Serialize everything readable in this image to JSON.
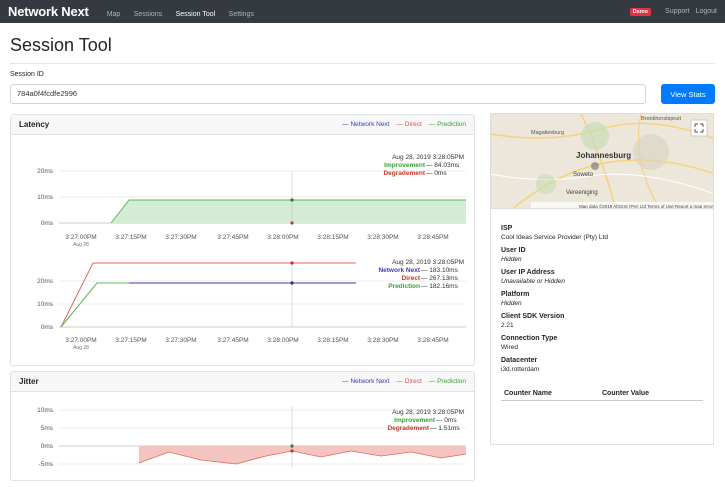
{
  "nav": {
    "brand": "Network Next",
    "links": [
      "Map",
      "Sessions",
      "Session Tool",
      "Settings"
    ],
    "badge": "Demo",
    "support": "Support",
    "logout": "Logout"
  },
  "page": {
    "title": "Session Tool",
    "session_label": "Session ID",
    "session_value": "784a0f4fcdfe2996",
    "view_button": "View Stats"
  },
  "latency": {
    "title": "Latency",
    "legend": [
      "— Network Next",
      "— Direct",
      "— Prediction"
    ],
    "chart1": {
      "timestamp": "Aug 28, 2019 3:28:05PM",
      "line1": "Improvement",
      "line1_val": "— 84.03ms",
      "line2": "Degradement",
      "line2_val": "— 0ms",
      "yticks": [
        "20ms",
        "10ms",
        "0ms"
      ]
    },
    "chart2": {
      "timestamp": "Aug 28, 2019 3:28:05PM",
      "line1": "Network Next",
      "line1_val": "— 183.10ms",
      "line2": "Direct",
      "line2_val": "— 267.13ms",
      "line3": "Prediction",
      "line3_val": "— 182.16ms",
      "yticks": [
        "20ms",
        "10ms",
        "0ms"
      ]
    },
    "xticks": [
      "3:27:00PM",
      "3:27:15PM",
      "3:27:30PM",
      "3:27:45PM",
      "3:28:00PM",
      "3:28:15PM",
      "3:28:30PM",
      "3:28:45PM"
    ],
    "xsub": "Aug 28"
  },
  "jitter": {
    "title": "Jitter",
    "legend": [
      "— Network Next",
      "— Direct",
      "— Prediction"
    ],
    "timestamp": "Aug 28, 2019 3:28:05PM",
    "line1": "Improvement",
    "line1_val": "— 0ms",
    "line2": "Degradement",
    "line2_val": "— 1.51ms",
    "yticks": [
      "10ms",
      "5ms",
      "0ms",
      "-5ms"
    ]
  },
  "map": {
    "labels": [
      "Johannesburg",
      "Soweto",
      "Vereeniging",
      "Magaliesburg",
      "Bronkhorstspruit"
    ],
    "attribution": "Map data ©2019 AfriGIS (Pty) Ltd   Terms of Use   Report a map error"
  },
  "info": {
    "isp_label": "ISP",
    "isp": "Cool Ideas Service Provider (Pty) Ltd",
    "user_id_label": "User ID",
    "user_id": "Hidden",
    "ip_label": "User IP Address",
    "ip": "Unavailable or Hidden",
    "platform_label": "Platform",
    "platform": "Hidden",
    "sdk_label": "Client SDK Version",
    "sdk": "2.21",
    "conn_label": "Connection Type",
    "conn": "Wired",
    "dc_label": "Datacenter",
    "dc": "i3d.rotterdam",
    "counter_name": "Counter Name",
    "counter_value": "Counter Value"
  },
  "colors": {
    "next": "#3b3bb3",
    "direct": "#e26a5a",
    "prediction": "#5cb85c",
    "fill_green": "#d4ecd4",
    "fill_red": "#f4c4c0"
  }
}
